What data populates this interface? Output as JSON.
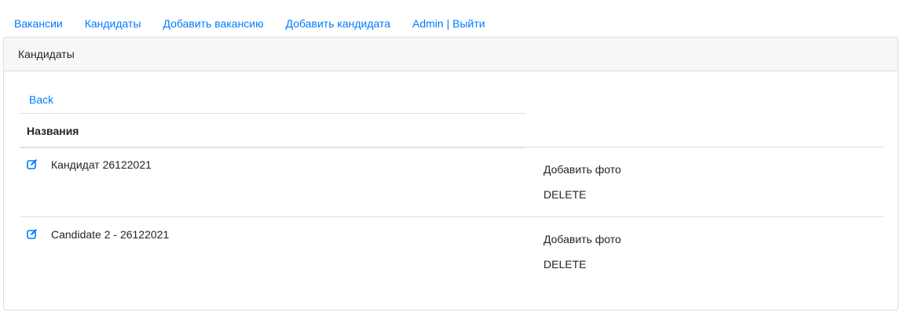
{
  "nav": {
    "items": [
      {
        "label": "Вакансии"
      },
      {
        "label": "Кандидаты"
      },
      {
        "label": "Добавить вакансию"
      },
      {
        "label": "Добавить кандидата"
      },
      {
        "label": "Admin | Выйти"
      }
    ]
  },
  "card": {
    "header": "Кандидаты",
    "back_label": "Back",
    "column_title": "Названия",
    "rows": [
      {
        "name": "Кандидат 26122021",
        "photo_label": "Добавить фото",
        "delete_label": "DELETE"
      },
      {
        "name": "Candidate 2 - 26122021",
        "photo_label": "Добавить фото",
        "delete_label": "DELETE"
      }
    ]
  },
  "icons": {
    "edit": "edit-icon"
  },
  "colors": {
    "link": "#007bff",
    "header_bg": "#f7f7f7",
    "border": "#dcdcdc"
  }
}
